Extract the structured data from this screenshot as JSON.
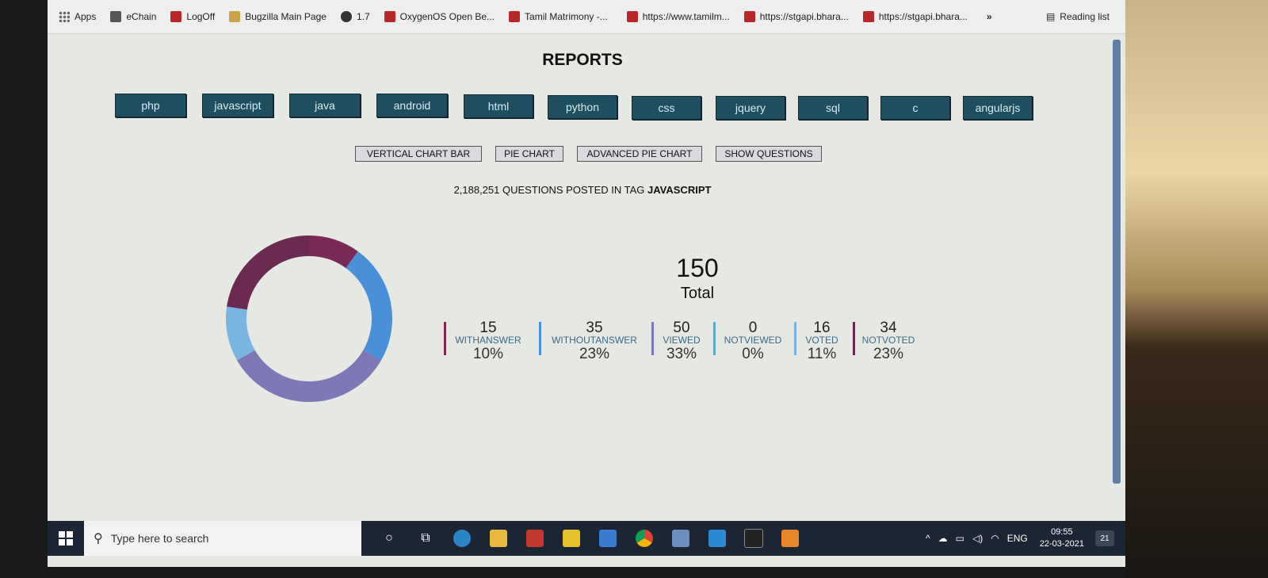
{
  "bookmarks": [
    {
      "label": "Apps",
      "icon": "apps-grid-icon"
    },
    {
      "label": "eChain",
      "icon": "echain-icon"
    },
    {
      "label": "LogOff",
      "icon": "logoff-icon"
    },
    {
      "label": "Bugzilla Main Page",
      "icon": "bugzilla-icon"
    },
    {
      "label": "1.7",
      "icon": "globe-icon"
    },
    {
      "label": "OxygenOS Open Be...",
      "icon": "oxygenos-icon"
    },
    {
      "label": "Tamil Matrimony -...",
      "icon": "matrimony-icon"
    },
    {
      "label": "https://www.tamilm...",
      "icon": "link-icon"
    },
    {
      "label": "https://stgapi.bhara...",
      "icon": "link-icon"
    },
    {
      "label": "https://stgapi.bhara...",
      "icon": "link-icon"
    }
  ],
  "bookmarks_more": "»",
  "reading_list": "Reading list",
  "page": {
    "title": "REPORTS",
    "tags": [
      "php",
      "javascript",
      "java",
      "android",
      "html",
      "python",
      "css",
      "jquery",
      "sql",
      "c",
      "angularjs"
    ],
    "report_buttons": [
      "VERTICAL CHART BAR",
      "PIE CHART",
      "ADVANCED PIE CHART",
      "SHOW QUESTIONS"
    ],
    "heading_prefix": "2,188,251 QUESTIONS POSTED IN TAG",
    "heading_tag": "JAVASCRIPT",
    "total_value": "150",
    "total_label": "Total"
  },
  "chart_data": {
    "type": "pie",
    "variant": "donut",
    "total": 150,
    "series": [
      {
        "name": "WITHANSWER",
        "value": 15,
        "percent": "10%",
        "color": "#7a2a55"
      },
      {
        "name": "WITHOUTANSWER",
        "value": 35,
        "percent": "23%",
        "color": "#4a90d9"
      },
      {
        "name": "VIEWED",
        "value": 50,
        "percent": "33%",
        "color": "#7f78b6"
      },
      {
        "name": "NOTVIEWED",
        "value": 0,
        "percent": "0%",
        "color": "#5fa8c8"
      },
      {
        "name": "VOTED",
        "value": 16,
        "percent": "11%",
        "color": "#7ab4e0"
      },
      {
        "name": "NOTVOTED",
        "value": 34,
        "percent": "23%",
        "color": "#6b2a50"
      }
    ]
  },
  "taskbar": {
    "search_placeholder": "Type here to search",
    "lang": "ENG",
    "time": "09:55",
    "date": "22-03-2021",
    "notifications": "21"
  }
}
